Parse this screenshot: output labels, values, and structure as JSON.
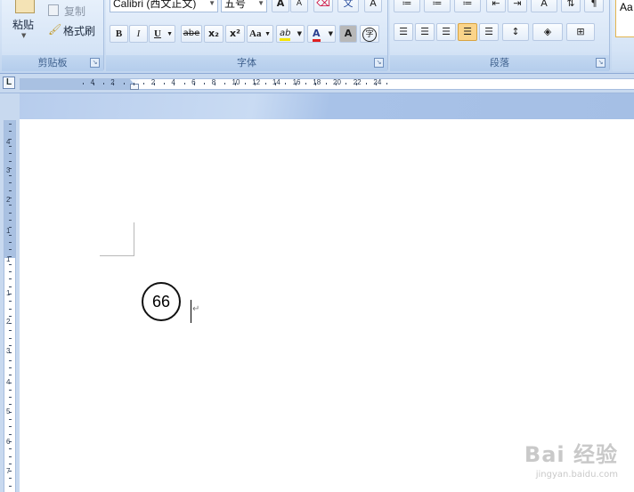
{
  "clipboard": {
    "paste_label": "粘贴",
    "copy_label": "复制",
    "format_painter_label": "格式刷",
    "group_label": "剪贴板"
  },
  "font": {
    "font_name": "Calibri (西文正文)",
    "font_size": "五号",
    "group_label": "字体",
    "bold": "B",
    "italic": "I",
    "underline": "U",
    "strikethrough": "abe",
    "subscript": "x₂",
    "superscript": "x²",
    "change_case": "Aa",
    "highlight": "ab",
    "font_color": "A",
    "char_shading": "A",
    "enclose_char": "字",
    "grow": "A",
    "shrink": "A",
    "clear": "文",
    "border": "A"
  },
  "paragraph": {
    "group_label": "段落"
  },
  "styles": {
    "preview": "Aa"
  },
  "ruler": {
    "corner": "L",
    "h_numbers": [
      "4",
      "2",
      "2",
      "4",
      "6",
      "8",
      "10",
      "12",
      "14",
      "16",
      "18",
      "20",
      "22",
      "24"
    ],
    "v_numbers": [
      "4",
      "3",
      "2",
      "1",
      "1",
      "1",
      "2",
      "3",
      "4",
      "5",
      "6",
      "7"
    ]
  },
  "document": {
    "enclosed_text": "66",
    "paragraph_mark": "↵"
  },
  "watermark": {
    "main": "Bai 经验",
    "sub": "jingyan.baidu.com"
  },
  "colors": {
    "accent_active": "#fbd48a",
    "font_color_red": "#e02020",
    "highlight_yellow": "#f5e400"
  }
}
